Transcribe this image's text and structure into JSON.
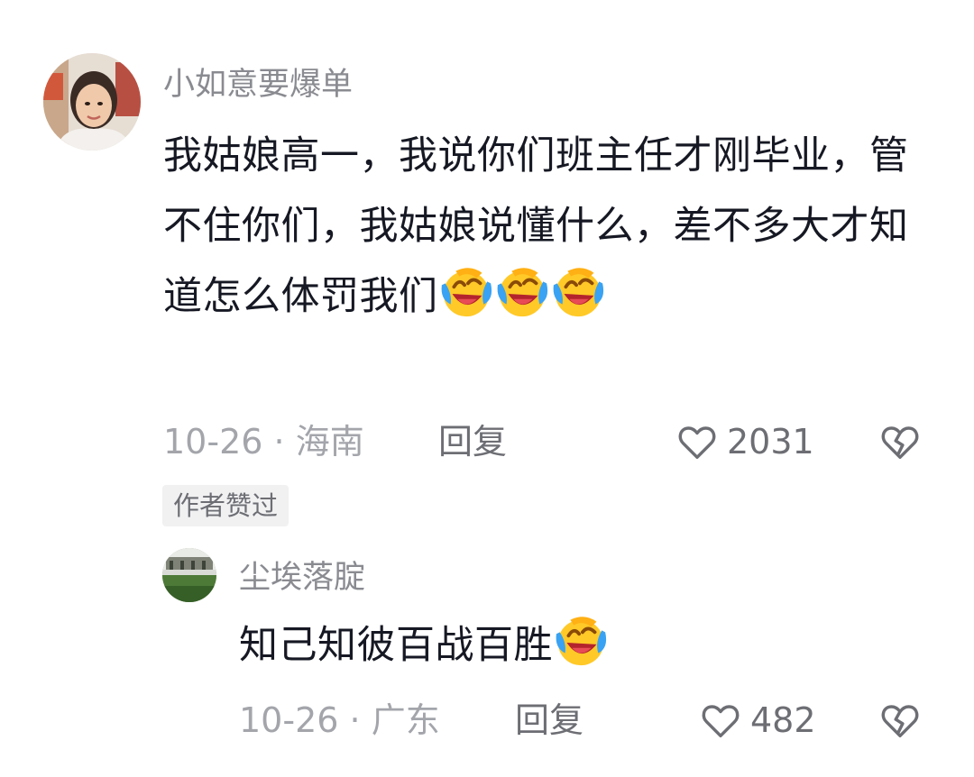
{
  "comment": {
    "username": "小如意要爆单",
    "text": "我姑娘高一，我说你们班主任才刚毕业，管不住你们，我姑娘说懂什么，差不多大才知道怎么体罚我们",
    "emoji_count": 3,
    "date": "10-26",
    "separator": "·",
    "location": "海南",
    "reply_label": "回复",
    "like_count": "2031",
    "badge": "作者赞过"
  },
  "reply": {
    "username": "尘埃落腚",
    "text": "知己知彼百战百胜",
    "emoji_count": 1,
    "date": "10-26",
    "separator": "·",
    "location": "广东",
    "reply_label": "回复",
    "like_count": "482"
  },
  "icons": {
    "emoji": "laughing-crying-emoji",
    "like": "heart-outline-icon",
    "dislike": "broken-heart-icon"
  },
  "colors": {
    "username": "#8a8b91",
    "text": "#161823",
    "meta": "#a3a5ab",
    "emoji_face": "#ffc928",
    "badge_bg": "#f1f1f2"
  }
}
